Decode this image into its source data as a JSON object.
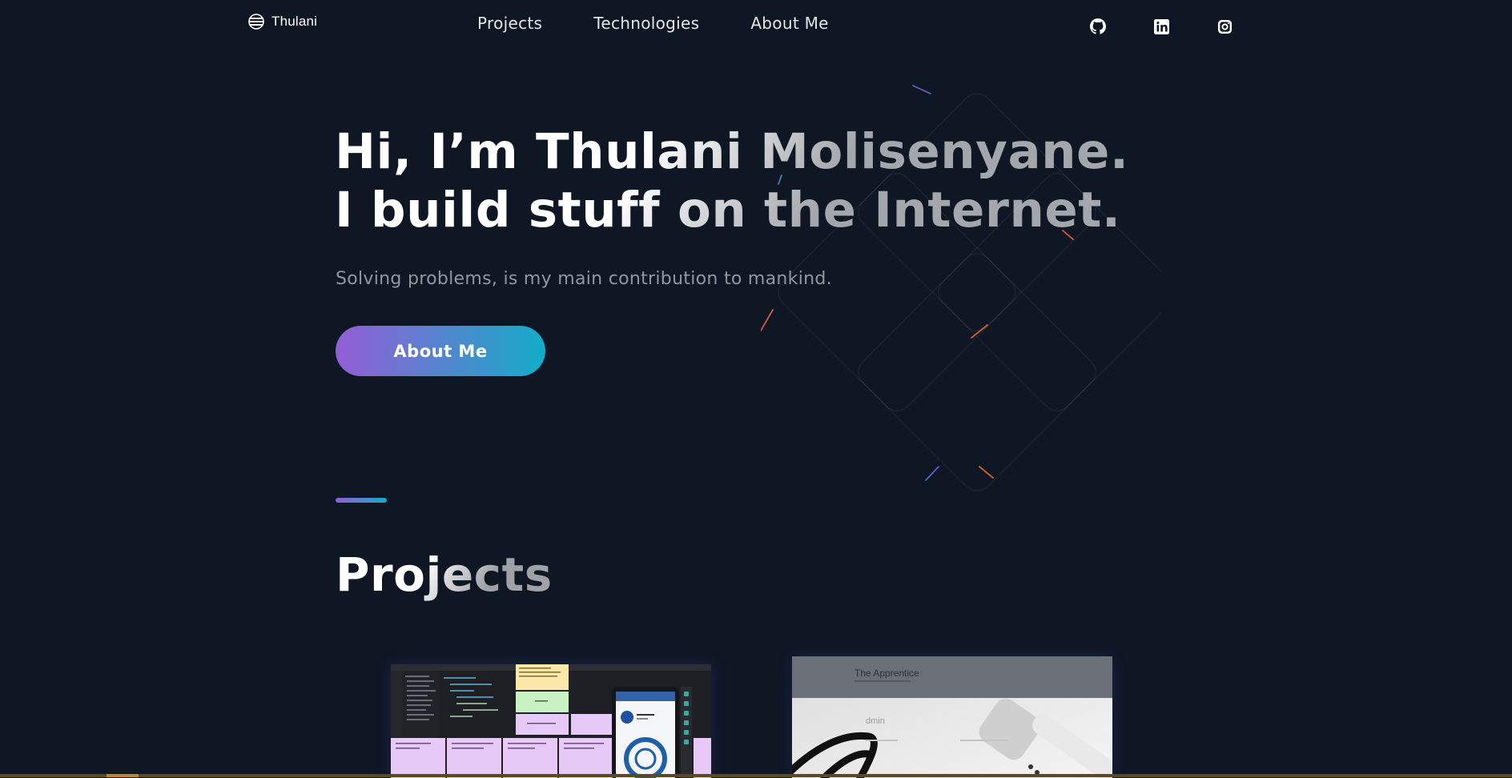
{
  "header": {
    "logo_text": "Thulani",
    "nav": [
      {
        "label": "Projects"
      },
      {
        "label": "Technologies"
      },
      {
        "label": "About Me"
      }
    ],
    "socials": [
      {
        "icon": "github-icon"
      },
      {
        "icon": "linkedin-icon"
      },
      {
        "icon": "instagram-icon"
      }
    ]
  },
  "hero": {
    "title_line1": "Hi, I’m Thulani Molisenyane.",
    "title_line2": "I build stuff on the Internet.",
    "subtitle": "Solving problems, is my main contribution to mankind.",
    "button_label": "About Me"
  },
  "projects": {
    "title": "Projects",
    "cards": [
      {
        "image": "code-editor-sticky-notes-screenshot"
      },
      {
        "image": "the-apprentice-site-screenshot",
        "caption_visible": "The Apprentice"
      }
    ]
  },
  "colors": {
    "background": "#0f1624",
    "gradient_start": "#945dd6",
    "gradient_mid": "#6978d1",
    "gradient_end": "#13adc7"
  }
}
